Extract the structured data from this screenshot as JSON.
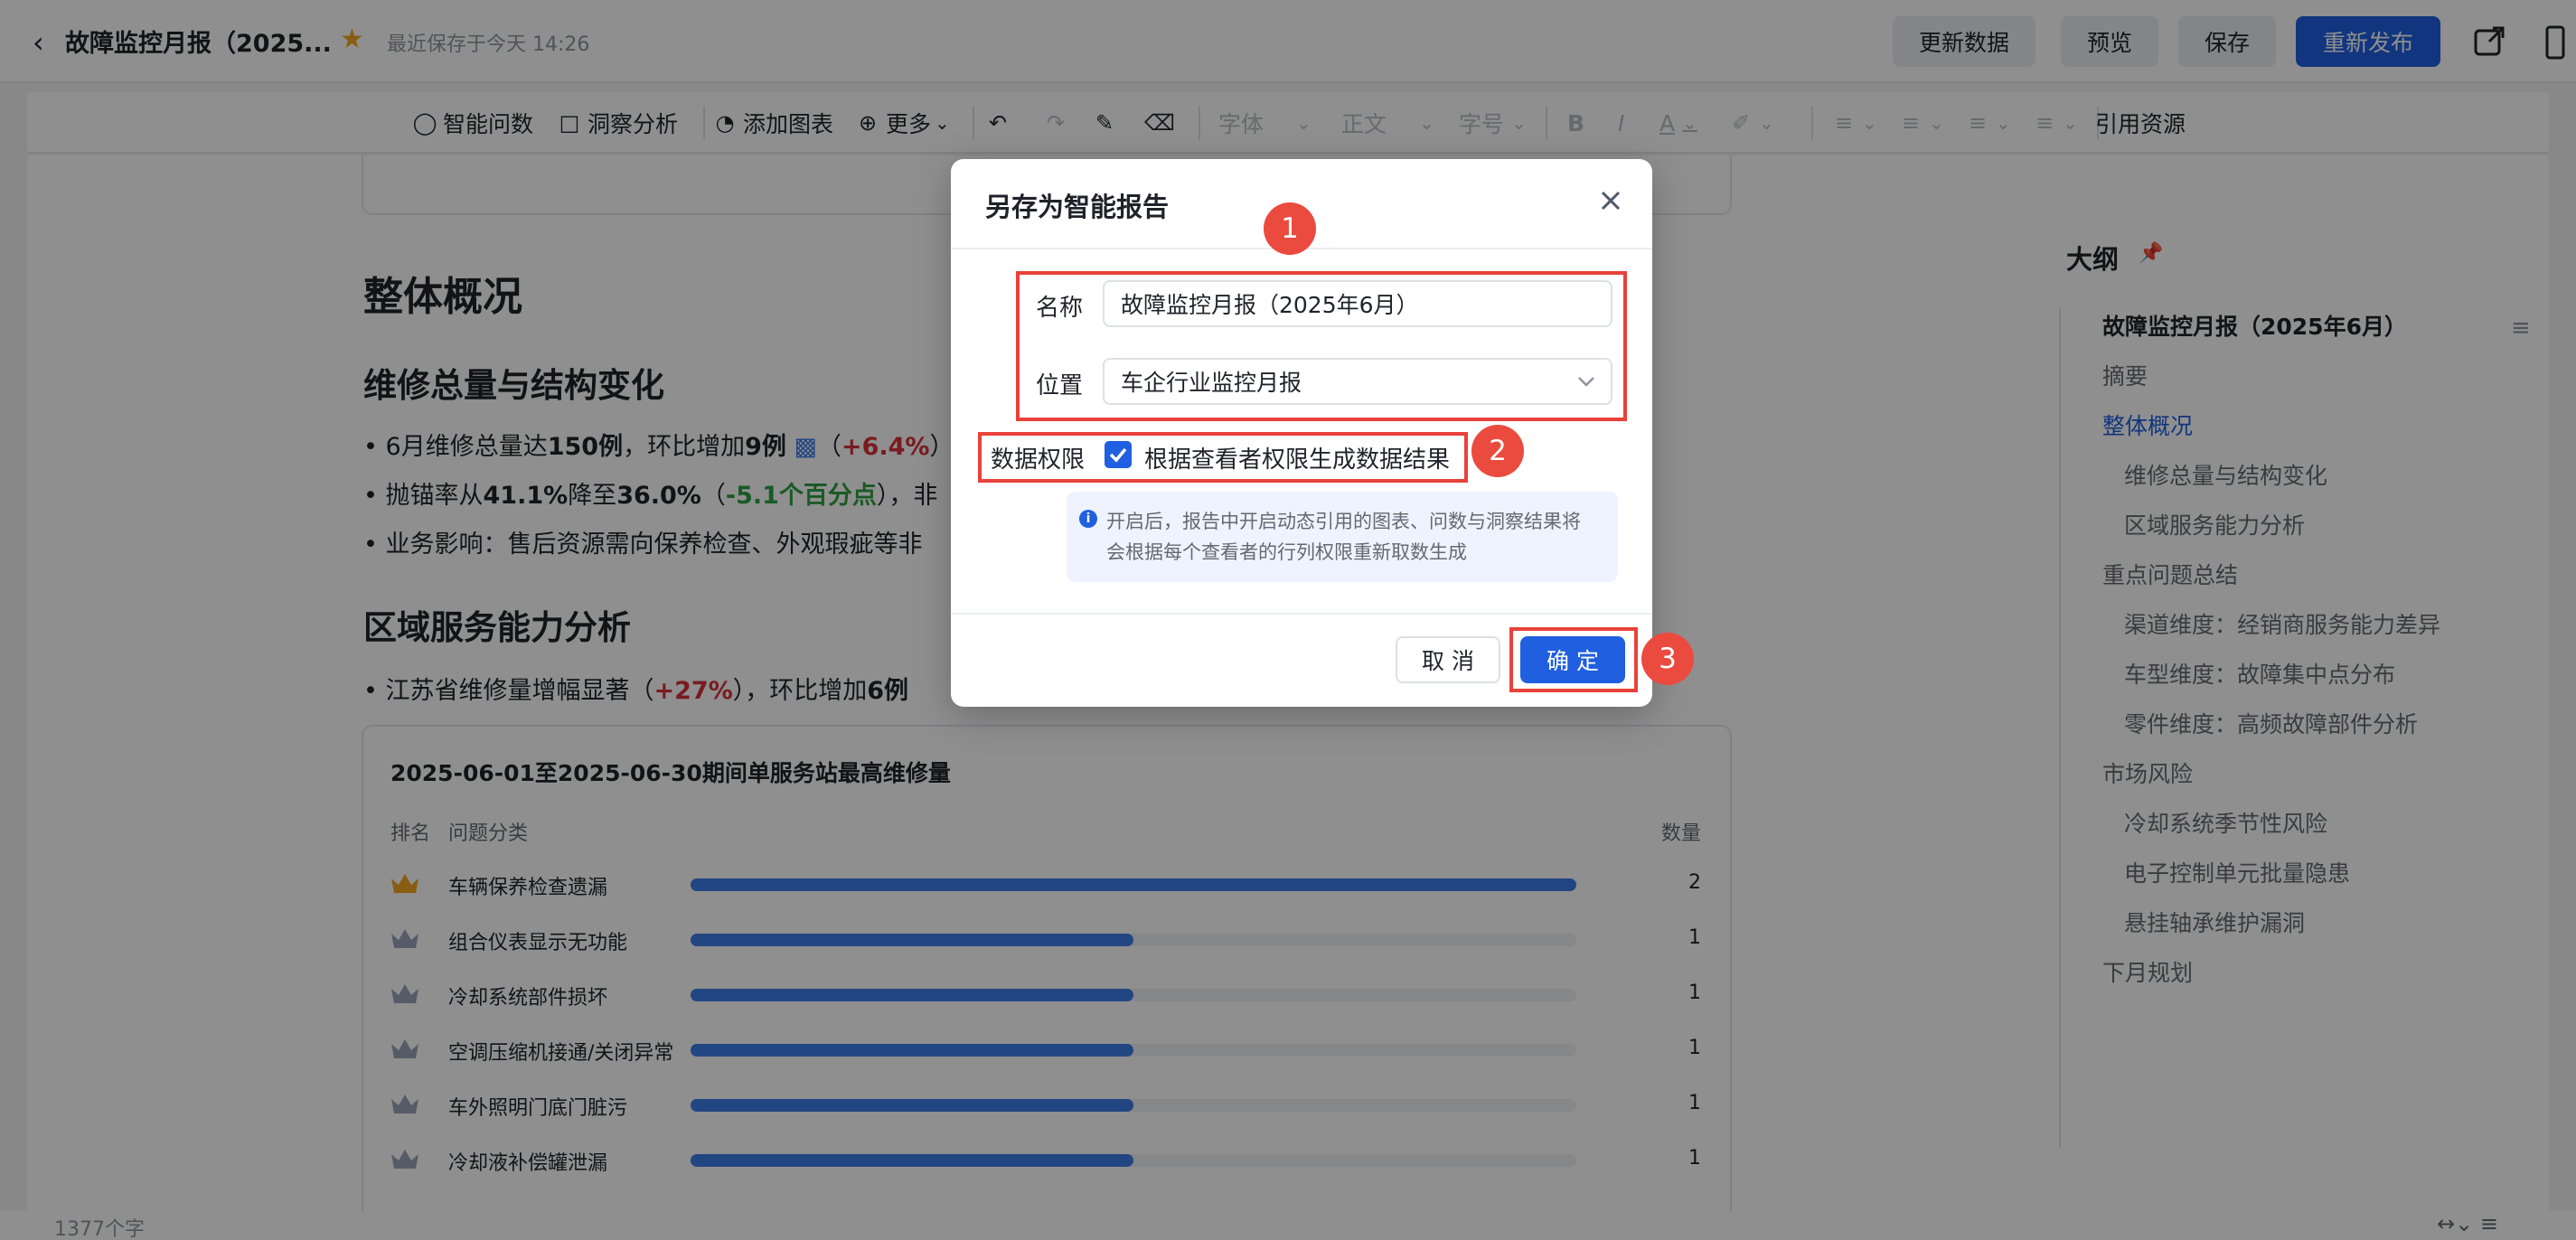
{
  "header": {
    "back_icon": "chevron-left-icon",
    "title": "故障监控月报（2025...",
    "star_icon": "star-icon",
    "saved_text": "最近保存于今天 14:26",
    "buttons": {
      "update": "更新数据",
      "preview": "预览",
      "save": "保存",
      "republish": "重新发布"
    },
    "share_icon": "share-icon",
    "panel_icon": "panel-icon",
    "accent": "#1f5fe0"
  },
  "toolbar": {
    "smart_query": "智能问数",
    "insight": "洞察分析",
    "add_chart": "添加图表",
    "more": "更多",
    "font": "字体",
    "paragraph": "正文",
    "font_size": "字号",
    "bold": "B",
    "italic": "I",
    "font_color": "A",
    "cite": "引用资源"
  },
  "content": {
    "section_title": "整体概况",
    "sub1": "维修总量与结构变化",
    "b1": {
      "prefix": "6月维修总量达",
      "v1": "150例",
      "mid": "，环比增加",
      "v2": "9例",
      "open": "（",
      "pct": "+6.4%",
      "close": "）"
    },
    "b2": {
      "prefix": "抛锚率从",
      "v1": "41.1%",
      "mid": "降至",
      "v2": "36.0%",
      "open": "（",
      "delta": "-5.1个百分点",
      "close": "），非"
    },
    "b3": "业务影响：售后资源需向保养检查、外观瑕疵等非",
    "sub2": "区域服务能力分析",
    "b4": {
      "prefix": "江苏省维修量增幅显著（",
      "pct": "+27%",
      "mid": "），环比增加",
      "v": "6例"
    }
  },
  "chart_data": {
    "type": "bar",
    "title": "2025-06-01至2025-06-30期间单服务站最高维修量",
    "headers": {
      "rank": "排名",
      "category": "问题分类",
      "count": "数量"
    },
    "categories": [
      "车辆保养检查遗漏",
      "组合仪表显示无功能",
      "冷却系统部件损坏",
      "空调压缩机接通/关闭异常",
      "车外照明门底门脏污",
      "冷却液补偿罐泄漏"
    ],
    "values": [
      2,
      1,
      1,
      1,
      1,
      1
    ],
    "xlim": [
      0,
      2
    ],
    "colors": {
      "bar": "#3d7de6",
      "track": "#eef0f3",
      "gold": "#f5a623",
      "silver": "#9aa4b8"
    }
  },
  "outline": {
    "title": "大纲",
    "pin_icon": "pin-icon",
    "items": [
      "故障监控月报（2025年6月）",
      "摘要",
      "整体概况",
      "维修总量与结构变化",
      "区域服务能力分析",
      "重点问题总结",
      "渠道维度：经销商服务能力差异",
      "车型维度：故障集中点分布",
      "零件维度：高频故障部件分析",
      "市场风险",
      "冷却系统季节性风险",
      "电子控制单元批量隐患",
      "悬挂轴承维护漏洞",
      "下月规划"
    ]
  },
  "footer": {
    "word_count": "1377个字"
  },
  "modal": {
    "title": "另存为智能报告",
    "name_label": "名称",
    "name_value": "故障监控月报（2025年6月）",
    "location_label": "位置",
    "location_value": "车企行业监控月报",
    "permission_label": "数据权限",
    "permission_checkbox": "根据查看者权限生成数据结果",
    "permission_checked": true,
    "info_line1": "开启后，报告中开启动态引用的图表、问数与洞察结果将",
    "info_line2": "会根据每个查看者的行列权限重新取数生成",
    "cancel": "取 消",
    "ok": "确 定"
  },
  "annotations": {
    "badge1": "1",
    "badge2": "2",
    "badge3": "3",
    "color": "#e8423a"
  }
}
